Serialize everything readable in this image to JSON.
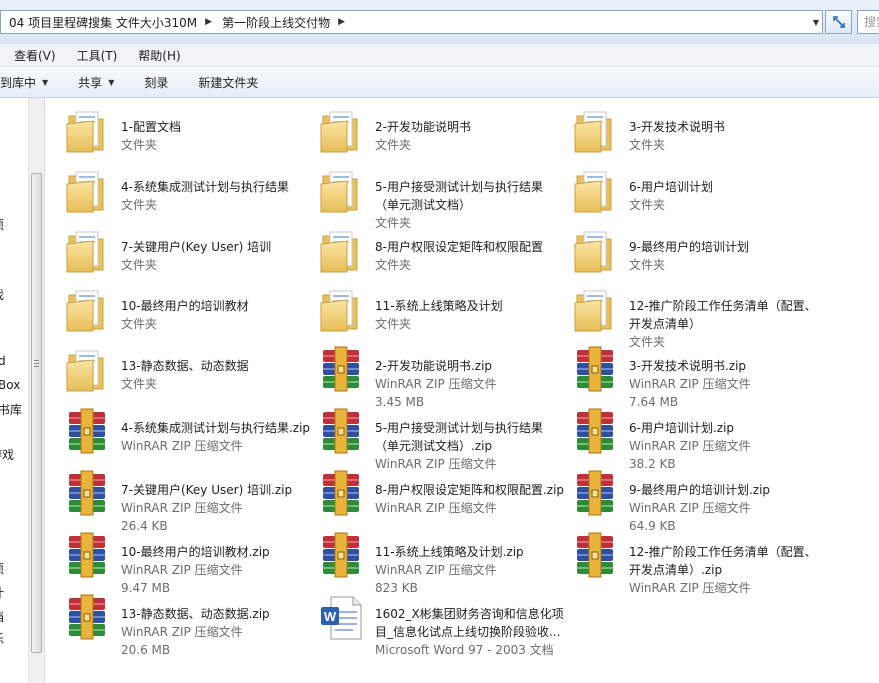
{
  "address": {
    "crumbs": [
      "04 项目里程碑搜集 文件大小310M",
      "第一阶段上线交付物"
    ],
    "search_placeholder": "搜索"
  },
  "menu": [
    "查看(V)",
    "工具(T)",
    "帮助(H)"
  ],
  "toolbar": {
    "include_library": "包含到库中",
    "share": "共享",
    "burn": "刻录",
    "new_folder": "新建文件夹"
  },
  "nav": [
    "项",
    "戏",
    "d",
    "Box",
    "书库",
    "游戏",
    "项",
    "计",
    "档",
    "乐"
  ],
  "files": [
    {
      "name": "1-配置文档",
      "type": "文件夹",
      "size": "",
      "icon": "folder-icon"
    },
    {
      "name": "2-开发功能说明书",
      "type": "文件夹",
      "size": "",
      "icon": "folder-icon"
    },
    {
      "name": "3-开发技术说明书",
      "type": "文件夹",
      "size": "",
      "icon": "folder-icon"
    },
    {
      "name": "4-系统集成测试计划与执行结果",
      "type": "文件夹",
      "size": "",
      "icon": "folder-icon"
    },
    {
      "name": "5-用户接受测试计划与执行结果（单元测试文档）",
      "type": "文件夹",
      "size": "",
      "icon": "folder-icon"
    },
    {
      "name": "6-用户培训计划",
      "type": "文件夹",
      "size": "",
      "icon": "folder-icon"
    },
    {
      "name": "7-关键用户(Key User) 培训",
      "type": "文件夹",
      "size": "",
      "icon": "folder-icon"
    },
    {
      "name": "8-用户权限设定矩阵和权限配置",
      "type": "文件夹",
      "size": "",
      "icon": "folder-icon"
    },
    {
      "name": "9-最终用户的培训计划",
      "type": "文件夹",
      "size": "",
      "icon": "folder-icon"
    },
    {
      "name": "10-最终用户的培训教材",
      "type": "文件夹",
      "size": "",
      "icon": "folder-icon"
    },
    {
      "name": "11-系统上线策略及计划",
      "type": "文件夹",
      "size": "",
      "icon": "folder-icon"
    },
    {
      "name": "12-推广阶段工作任务清单（配置、开发点清单）",
      "type": "文件夹",
      "size": "",
      "icon": "folder-icon"
    },
    {
      "name": "13-静态数据、动态数据",
      "type": "文件夹",
      "size": "",
      "icon": "folder-icon"
    },
    {
      "name": "2-开发功能说明书.zip",
      "type": "WinRAR ZIP 压缩文件",
      "size": "3.45 MB",
      "icon": "winrar-icon"
    },
    {
      "name": "3-开发技术说明书.zip",
      "type": "WinRAR ZIP 压缩文件",
      "size": "7.64 MB",
      "icon": "winrar-icon"
    },
    {
      "name": "4-系统集成测试计划与执行结果.zip",
      "type": "WinRAR ZIP 压缩文件",
      "size": "",
      "icon": "winrar-icon"
    },
    {
      "name": "5-用户接受测试计划与执行结果（单元测试文档）.zip",
      "type": "WinRAR ZIP 压缩文件",
      "size": "",
      "icon": "winrar-icon"
    },
    {
      "name": "6-用户培训计划.zip",
      "type": "WinRAR ZIP 压缩文件",
      "size": "38.2 KB",
      "icon": "winrar-icon"
    },
    {
      "name": "7-关键用户(Key User) 培训.zip",
      "type": "WinRAR ZIP 压缩文件",
      "size": "26.4 KB",
      "icon": "winrar-icon"
    },
    {
      "name": "8-用户权限设定矩阵和权限配置.zip",
      "type": "WinRAR ZIP 压缩文件",
      "size": "",
      "icon": "winrar-icon"
    },
    {
      "name": "9-最终用户的培训计划.zip",
      "type": "WinRAR ZIP 压缩文件",
      "size": "64.9 KB",
      "icon": "winrar-icon"
    },
    {
      "name": "10-最终用户的培训教材.zip",
      "type": "WinRAR ZIP 压缩文件",
      "size": "9.47 MB",
      "icon": "winrar-icon"
    },
    {
      "name": "11-系统上线策略及计划.zip",
      "type": "WinRAR ZIP 压缩文件",
      "size": "823 KB",
      "icon": "winrar-icon"
    },
    {
      "name": "12-推广阶段工作任务清单（配置、开发点清单）.zip",
      "type": "WinRAR ZIP 压缩文件",
      "size": "",
      "icon": "winrar-icon"
    },
    {
      "name": "13-静态数据、动态数据.zip",
      "type": "WinRAR ZIP 压缩文件",
      "size": "20.6 MB",
      "icon": "winrar-icon"
    },
    {
      "name": "1602_X彬集团财务咨询和信息化项目_信息化试点上线切换阶段验收...",
      "type": "Microsoft Word 97 - 2003 文档",
      "size": "",
      "icon": "word-icon"
    }
  ],
  "colors": {
    "accent": "#3d7dca",
    "folder": "#f3d27a",
    "rar_red": "#c0303a",
    "rar_blue": "#2f4fa0",
    "rar_green": "#2e8b3a"
  }
}
